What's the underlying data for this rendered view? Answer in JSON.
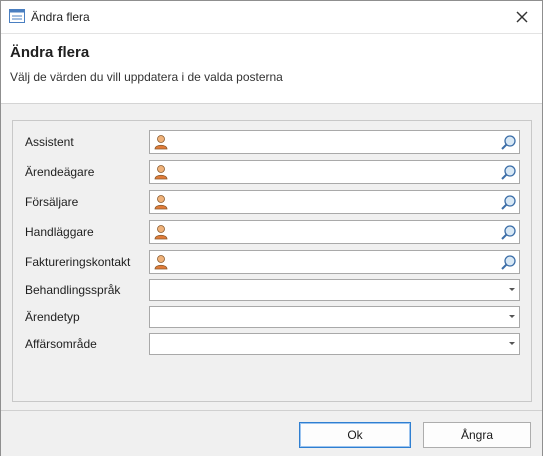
{
  "window": {
    "title": "Ändra flera",
    "close_icon": "close-icon",
    "app_icon": "form-window-icon"
  },
  "header": {
    "title": "Ändra flera",
    "subtitle": "Välj de värden du vill uppdatera i de valda posterna"
  },
  "fields": [
    {
      "label": "Assistent",
      "type": "lookup",
      "value": ""
    },
    {
      "label": "Ärendeägare",
      "type": "lookup",
      "value": ""
    },
    {
      "label": "Försäljare",
      "type": "lookup",
      "value": ""
    },
    {
      "label": "Handläggare",
      "type": "lookup",
      "value": ""
    },
    {
      "label": "Faktureringskontakt",
      "type": "lookup",
      "value": ""
    },
    {
      "label": "Behandlingsspråk",
      "type": "dropdown",
      "value": ""
    },
    {
      "label": "Ärendetyp",
      "type": "dropdown",
      "value": ""
    },
    {
      "label": "Affärsområde",
      "type": "dropdown",
      "value": ""
    }
  ],
  "buttons": {
    "ok": "Ok",
    "cancel": "Ångra"
  },
  "colors": {
    "default_button_border": "#2f7fd1",
    "person_icon_skin": "#f0b27a",
    "person_icon_body": "#e07b39"
  }
}
